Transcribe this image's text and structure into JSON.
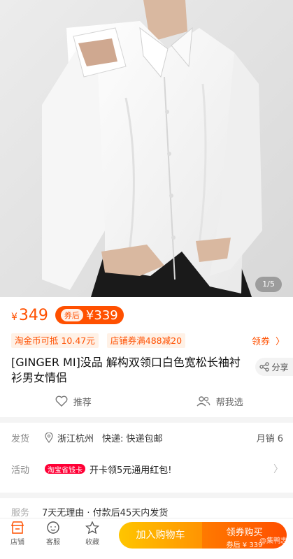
{
  "gallery": {
    "counter": "1/5"
  },
  "price": {
    "currency": "¥",
    "current": "349",
    "after_label": "券后",
    "after_value": "¥339",
    "accent": "#ff5000"
  },
  "coupons": {
    "tag1": "淘金币可抵 10.47元",
    "tag2": "店铺券满488减20",
    "link": "领券",
    "chevron": "〉"
  },
  "product": {
    "title": "[GINGER MI]没品 解构双领口白色宽松长袖衬衫男女情侣",
    "share": "分享"
  },
  "actions": {
    "recommend": "推荐",
    "help_choose": "帮我选"
  },
  "shipping": {
    "label": "发货",
    "location": "浙江杭州",
    "express": "快递: 快递包邮",
    "monthly_sales": "月销 6"
  },
  "activity": {
    "label": "活动",
    "badge": "淘宝省钱卡",
    "text": "开卡领5元通用红包!",
    "chevron": "〉"
  },
  "service": {
    "label": "服务",
    "text": "7天无理由 · 付款后45天内发货"
  },
  "bottom_bar": {
    "store": "店铺",
    "support": "客服",
    "favorite": "收藏",
    "add_to_cart": "加入购物车",
    "buy_title": "领券购买",
    "buy_sub": "券后 ¥ 339",
    "watermark": "@集鸭志"
  }
}
